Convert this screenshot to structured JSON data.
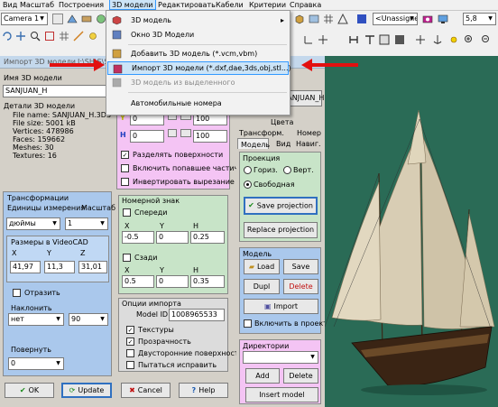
{
  "menubar": {
    "items": [
      "Вид",
      "Масштаб",
      "Построения",
      "3D модели",
      "Редактировать",
      "Кабели",
      "Критерии",
      "Справка"
    ]
  },
  "toolbar": {
    "camera": "Camera 1",
    "unassigned": "<Unassigne",
    "zoom": "5,8"
  },
  "dropdown_menu": {
    "items": [
      {
        "label": "3D модель",
        "icon": "cube-icon",
        "submenu": true
      },
      {
        "label": "Окно 3D Модели",
        "icon": "window-3d-icon"
      },
      {
        "label": "Добавить 3D модель (*.vcm,vbm)",
        "icon": "add-model-icon"
      },
      {
        "label": "Импорт 3D модели (*.dxf,dae,3ds,obj,stl...)",
        "icon": "import-model-icon",
        "highlighted": true
      },
      {
        "label": "3D модель из выделенного",
        "icon": "model-from-selection-icon",
        "disabled": true
      },
      {
        "label": "Автомобильные номера",
        "icon": ""
      }
    ]
  },
  "dialog": {
    "title": "Импорт 3D модели",
    "title_path": "J:\\SH\\S\\SA",
    "model_name_label": "Имя 3D модели",
    "model_name": "SANJUAN_H",
    "details_label": "Детали 3D модели",
    "details": [
      "File name: SANJUAN_H.3DS",
      "File size: 5001 kB",
      "Vertices: 478986",
      "Faces: 159662",
      "Meshes: 30",
      "Textures: 16"
    ],
    "transform": {
      "title": "Трансформации",
      "units_label": "Единицы измерения",
      "scale_label": "Масштаб",
      "units_value": "дюймы",
      "scale_value": "1",
      "size_title": "Размеры в VideoCAD",
      "x_label": "X",
      "y_label": "Y",
      "z_label": "Z",
      "x": "41,97",
      "y": "11,3",
      "z": "31,01",
      "mirror_label": "Отразить",
      "tilt_label": "Наклонить",
      "tilt_value": "нет",
      "tilt_angle": "90",
      "rotate_label": "Повернуть",
      "rotate_value": "0"
    },
    "texture_panel": {
      "y_label": "Y",
      "h_label": "H",
      "y_left": "0",
      "y_right": "100",
      "h_left": "0",
      "h_right": "100",
      "split_surfaces": "Разделять поверхности",
      "include_partial": "Включить попавшее частично",
      "invert_cut": "Инвертировать вырезание",
      "confirm_button": "H"
    },
    "plate": {
      "title": "Номерной знак",
      "front_label": "Спереди",
      "rear_label": "Сзади",
      "x_label": "X",
      "y_label": "Y",
      "h_label": "H",
      "front": {
        "x": "-0.5",
        "y": "0",
        "h": "0.25"
      },
      "rear": {
        "x": "0.5",
        "y": "0",
        "h": "0.35"
      }
    },
    "import_options": {
      "title": "Опции импорта",
      "model_id_label": "Model ID",
      "model_id": "1008965533",
      "textures": "Текстуры",
      "transparency": "Прозрачность",
      "two_sided": "Двусторонние поверхности",
      "try_fix": "Пытаться исправить"
    },
    "buttons": {
      "ok": "OK",
      "update": "Update",
      "cancel": "Cancel",
      "help": "Help"
    }
  },
  "right_panel": {
    "colors_label": "Цвета",
    "tabs_row1": [
      "Трансформ.",
      "Номер"
    ],
    "tabs_row2": [
      "Модель",
      "Вид",
      "Навиг."
    ],
    "projection": {
      "title": "Проекция",
      "horiz": "Гориз.",
      "vert": "Верт.",
      "free": "Свободная",
      "save_button": "Save projection",
      "replace_button": "Replace projection"
    },
    "model": {
      "title": "Модель",
      "load": "Load",
      "save": "Save",
      "dupl": "Dupl",
      "delete": "Delete",
      "import": "Import",
      "include_in_project": "Включить в проект"
    },
    "directories": {
      "title": "Директории",
      "add": "Add",
      "delete": "Delete",
      "insert": "Insert model"
    }
  }
}
